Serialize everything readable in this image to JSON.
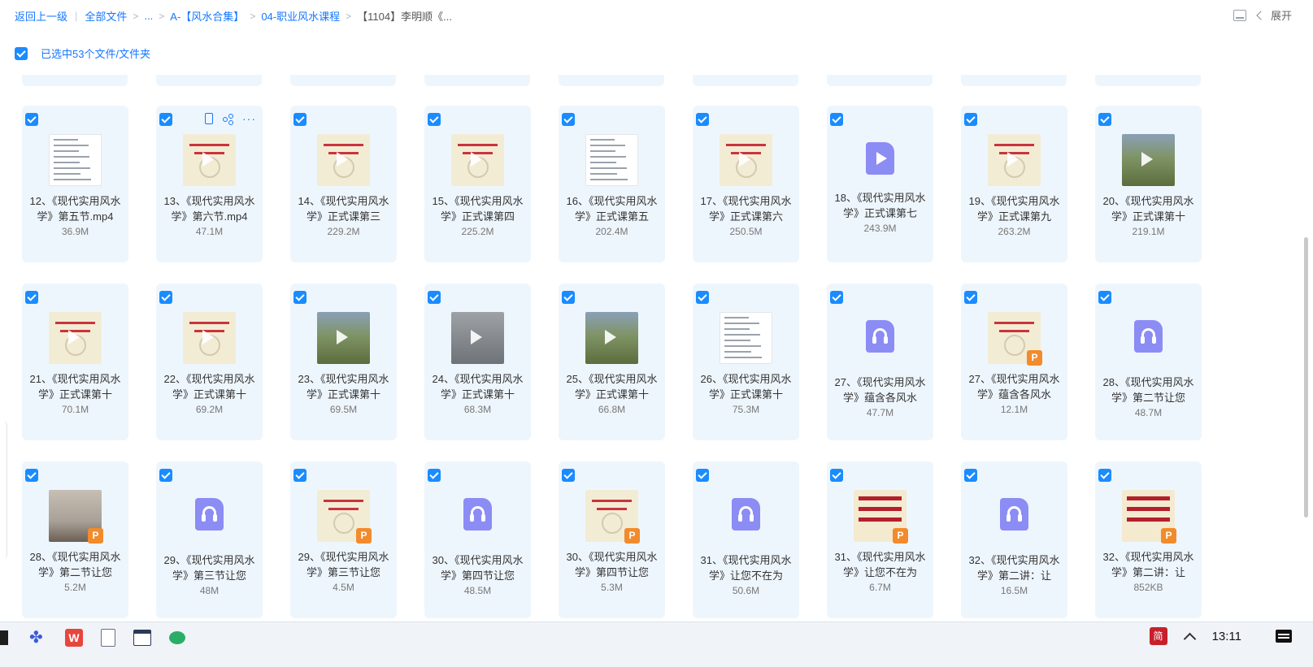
{
  "breadcrumb": {
    "back": "返回上一级",
    "all_files": "全部文件",
    "ellipsis": "...",
    "folder1": "A-【风水合集】",
    "folder2": "04-职业风水课程",
    "current": "【1104】李明顺《..."
  },
  "toolbar": {
    "expand_label": "展开"
  },
  "selection": {
    "text": "已选中53个文件/文件夹"
  },
  "files": [
    {
      "name": "12、《现代实用风水学》第五节.mp4",
      "size": "36.9M",
      "thumb": "doc"
    },
    {
      "name": "13、《现代实用风水学》第六节.mp4",
      "size": "47.1M",
      "thumb": "slide"
    },
    {
      "name": "14、《现代实用风水学》正式课第三",
      "size": "229.2M",
      "thumb": "slide"
    },
    {
      "name": "15、《现代实用风水学》正式课第四",
      "size": "225.2M",
      "thumb": "slide"
    },
    {
      "name": "16、《现代实用风水学》正式课第五",
      "size": "202.4M",
      "thumb": "doc"
    },
    {
      "name": "17、《现代实用风水学》正式课第六",
      "size": "250.5M",
      "thumb": "slide"
    },
    {
      "name": "18、《现代实用风水学》正式课第七",
      "size": "243.9M",
      "thumb": "video-icon"
    },
    {
      "name": "19、《现代实用风水学》正式课第九",
      "size": "263.2M",
      "thumb": "slide"
    },
    {
      "name": "20、《现代实用风水学》正式课第十",
      "size": "219.1M",
      "thumb": "photo"
    },
    {
      "name": "21、《现代实用风水学》正式课第十",
      "size": "70.1M",
      "thumb": "slide"
    },
    {
      "name": "22、《现代实用风水学》正式课第十",
      "size": "69.2M",
      "thumb": "slide"
    },
    {
      "name": "23、《现代实用风水学》正式课第十",
      "size": "69.5M",
      "thumb": "photo"
    },
    {
      "name": "24、《现代实用风水学》正式课第十",
      "size": "68.3M",
      "thumb": "gray"
    },
    {
      "name": "25、《现代实用风水学》正式课第十",
      "size": "66.8M",
      "thumb": "photo"
    },
    {
      "name": "26、《现代实用风水学》正式课第十",
      "size": "75.3M",
      "thumb": "doc"
    },
    {
      "name": "27、《现代实用风水学》蕴含各风水",
      "size": "47.7M",
      "thumb": "audio-icon"
    },
    {
      "name": "27、《现代实用风水学》蕴含各风水",
      "size": "12.1M",
      "thumb": "slide-p"
    },
    {
      "name": "28、《现代实用风水学》第二节让您",
      "size": "48.7M",
      "thumb": "audio-icon"
    },
    {
      "name": "28、《现代实用风水学》第二节让您",
      "size": "5.2M",
      "thumb": "room-p"
    },
    {
      "name": "29、《现代实用风水学》第三节让您",
      "size": "48M",
      "thumb": "audio-icon"
    },
    {
      "name": "29、《现代实用风水学》第三节让您",
      "size": "4.5M",
      "thumb": "slide-p"
    },
    {
      "name": "30、《现代实用风水学》第四节让您",
      "size": "48.5M",
      "thumb": "audio-icon"
    },
    {
      "name": "30、《现代实用风水学》第四节让您",
      "size": "5.3M",
      "thumb": "slide-p"
    },
    {
      "name": "31、《现代实用风水学》让您不在为",
      "size": "50.6M",
      "thumb": "audio-icon"
    },
    {
      "name": "31、《现代实用风水学》让您不在为",
      "size": "6.7M",
      "thumb": "redtext-p"
    },
    {
      "name": "32、《现代实用风水学》第二讲：让",
      "size": "16.5M",
      "thumb": "audio-icon"
    },
    {
      "name": "32、《现代实用风水学》第二讲：让",
      "size": "852KB",
      "thumb": "redtext-p"
    }
  ],
  "taskbar": {
    "w_icon": "W",
    "tray_badge": "简",
    "time": "13:11"
  },
  "colors": {
    "accent": "#1677ff",
    "card_bg": "#eef6fd",
    "type_icon": "#8c8cf5",
    "ppt_badge": "#f28b2c"
  }
}
